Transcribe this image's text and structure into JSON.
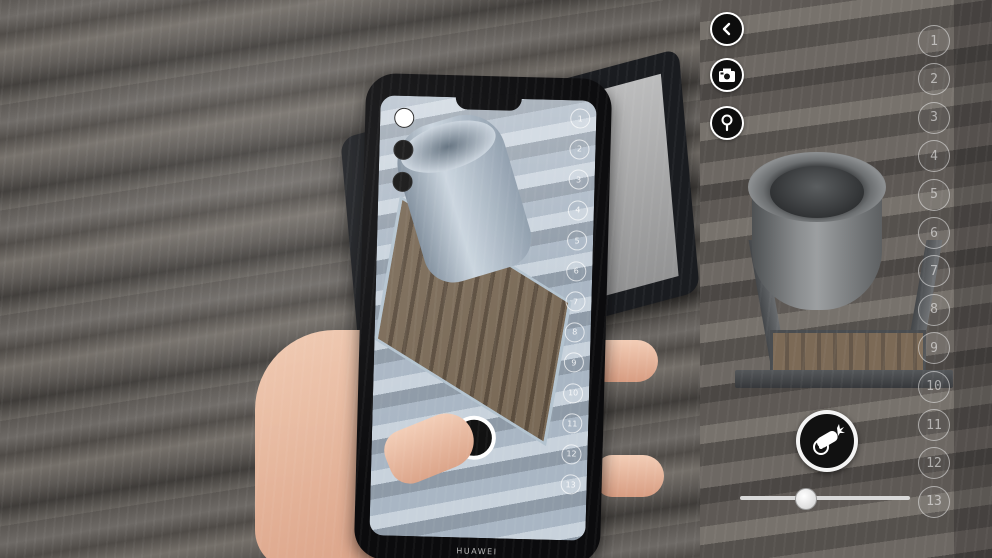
{
  "scene": {
    "phone_brand": "HUAWEI"
  },
  "ar_app": {
    "buttons": {
      "back_icon": "chevron-left-icon",
      "camera_icon": "camera-icon",
      "hint_icon": "magnifier-icon",
      "fire_icon": "cannon-icon"
    },
    "levels": [
      "1",
      "2",
      "3",
      "4",
      "5",
      "6",
      "7",
      "8",
      "9",
      "10",
      "11",
      "12",
      "13"
    ],
    "slider": {
      "value_fraction": 0.38
    },
    "colors": {
      "button_bg": "#0d0d0d",
      "button_ring": "#ffffff",
      "level_ring": "#ebebeb"
    }
  }
}
